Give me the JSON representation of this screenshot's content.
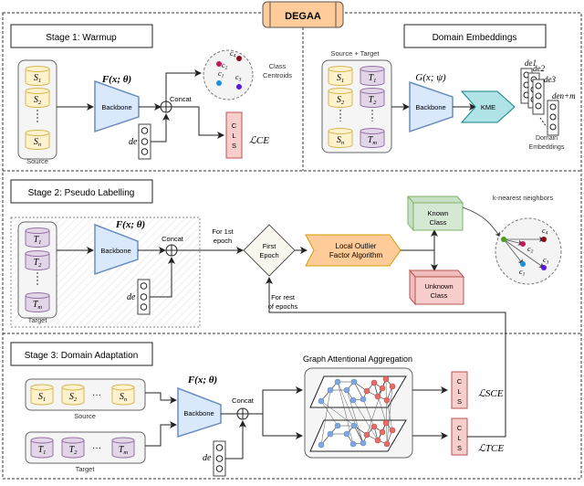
{
  "title": "DEGAA",
  "colors": {
    "source_fill": "#fff2cc",
    "source_stroke": "#d6b656",
    "target_fill": "#e1d5e7",
    "target_stroke": "#9673a6",
    "backbone_fill": "#dae8fc",
    "backbone_stroke": "#6c8ebf",
    "cls_fill": "#f8cecc",
    "cls_stroke": "#b85450",
    "kme_fill": "#b0e3e6",
    "kme_stroke": "#0e8088",
    "lof_fill": "#ffcc99",
    "lof_stroke": "#d79b00",
    "known_fill": "#d5e8d4",
    "known_stroke": "#82b366",
    "title_fill": "#ffcc99",
    "c1": "#1b8fe0",
    "c2": "#c2185b",
    "c3": "#5b18e0",
    "c4": "#8b0a16",
    "knn_center": "#4d9a1e"
  },
  "stage1": {
    "title": "Stage 1: Warmup",
    "source_items": [
      "S1",
      "S2",
      "Sn"
    ],
    "source_label": "Source",
    "backbone_label": "Backbone",
    "backbone_func": "F(x; θ)",
    "concat_label": "Concat",
    "domain_vector_label": "de",
    "centroids_label_line1": "Class",
    "centroids_label_line2": "Centroids",
    "centroids": [
      "c1",
      "c2",
      "c3",
      "c4"
    ],
    "cls_letters": [
      "C",
      "L",
      "S"
    ],
    "loss_label": "ℒCE"
  },
  "domain_embeddings": {
    "title": "Domain Embeddings",
    "group_label": "Source + Target",
    "source_items": [
      "S1",
      "S2",
      "Sn"
    ],
    "target_items": [
      "T1",
      "T2",
      "Tm"
    ],
    "backbone_label": "Backbone",
    "backbone_func": "G(x; ψ)",
    "kme_label": "KME",
    "embedding_labels": [
      "de1",
      "de2",
      "de3",
      "den+m"
    ],
    "embeddings_caption_line1": "Domain",
    "embeddings_caption_line2": "Embeddings"
  },
  "stage2": {
    "title": "Stage 2: Pseudo Labelling",
    "target_items": [
      "T1",
      "T2",
      "Tm"
    ],
    "target_label": "Target",
    "backbone_label": "Backbone",
    "backbone_func": "F(x; θ)",
    "concat_label": "Concat",
    "domain_vector_label": "de",
    "first_epoch_note_line1": "For 1st",
    "first_epoch_note_line2": "epoch",
    "decision_line1": "First",
    "decision_line2": "Epoch",
    "lof_line1": "Local Outlier",
    "lof_line2": "Factor Algorithm",
    "known_line1": "Known",
    "known_line2": "Class",
    "unknown_line1": "Unknown",
    "unknown_line2": "Class",
    "rest_note_line1": "For rest",
    "rest_note_line2": "of epochs",
    "knn_label": "k-nearest neighbors",
    "knn_centroids": [
      "c1",
      "c2",
      "c3",
      "c4"
    ]
  },
  "stage3": {
    "title": "Stage 3: Domain Adaptation",
    "source_items": [
      "S1",
      "S2",
      "Sn"
    ],
    "source_label": "Source",
    "target_items": [
      "T1",
      "T2",
      "Tm"
    ],
    "target_label": "Target",
    "backbone_label": "Backbone",
    "backbone_func": "F(x; θ)",
    "concat_label": "Concat",
    "domain_vector_label": "de",
    "graph_title": "Graph Attentional Aggregation",
    "cls_letters": [
      "C",
      "L",
      "S"
    ],
    "loss_source": "ℒSCE",
    "loss_target": "ℒTCE"
  }
}
